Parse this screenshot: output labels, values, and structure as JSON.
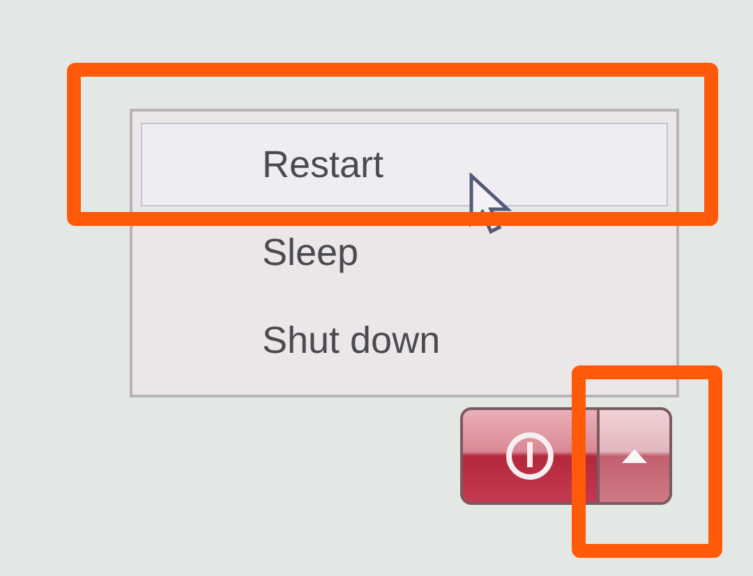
{
  "menu": {
    "items": [
      {
        "label": "Restart",
        "selected": true
      },
      {
        "label": "Sleep",
        "selected": false
      },
      {
        "label": "Shut down",
        "selected": false
      }
    ]
  }
}
